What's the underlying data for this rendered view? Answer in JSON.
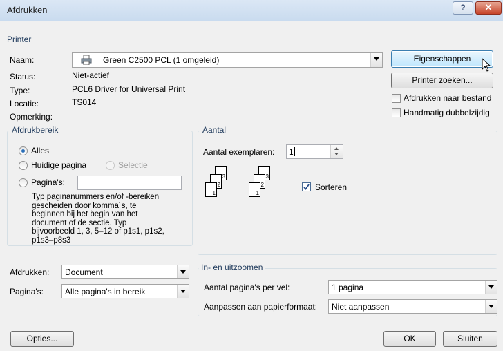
{
  "window": {
    "title": "Afdrukken",
    "help": "?",
    "close": "✕"
  },
  "printer": {
    "legend": "Printer",
    "name_label": "Naam:",
    "name_value": "Green C2500 PCL (1 omgeleid)",
    "status_label": "Status:",
    "status_value": "Niet-actief",
    "type_label": "Type:",
    "type_value": "PCL6 Driver for Universal Print",
    "location_label": "Locatie:",
    "location_value": "TS014",
    "comment_label": "Opmerking:",
    "properties_button": "Eigenschappen",
    "find_printer_button": "Printer zoeken...",
    "print_to_file": "Afdrukken naar bestand",
    "manual_duplex": "Handmatig dubbelzijdig"
  },
  "range": {
    "legend": "Afdrukbereik",
    "all": "Alles",
    "current_page": "Huidige pagina",
    "selection": "Selectie",
    "pages": "Pagina's:",
    "pages_value": "",
    "help_text": [
      "Typ paginanummers en/of -bereiken",
      "gescheiden door komma´s, te",
      "beginnen bij het begin van het",
      "document of de sectie. Typ",
      "bijvoorbeeld 1, 3, 5–12 of p1s1, p1s2,",
      "p1s3–p8s3"
    ]
  },
  "copies": {
    "legend": "Aantal",
    "count_label": "Aantal exemplaren:",
    "count_value": "1",
    "collate": "Sorteren",
    "page_numbers": [
      "1",
      "2",
      "3"
    ]
  },
  "print_what": {
    "label": "Afdrukken:",
    "value": "Document"
  },
  "print_pages": {
    "label": "Pagina's:",
    "value": "Alle pagina's in bereik"
  },
  "zoom": {
    "legend": "In- en uitzoomen",
    "per_sheet_label": "Aantal pagina's per vel:",
    "per_sheet_value": "1 pagina",
    "scale_label": "Aanpassen aan papierformaat:",
    "scale_value": "Niet aanpassen"
  },
  "buttons": {
    "options": "Opties...",
    "ok": "OK",
    "close": "Sluiten"
  }
}
